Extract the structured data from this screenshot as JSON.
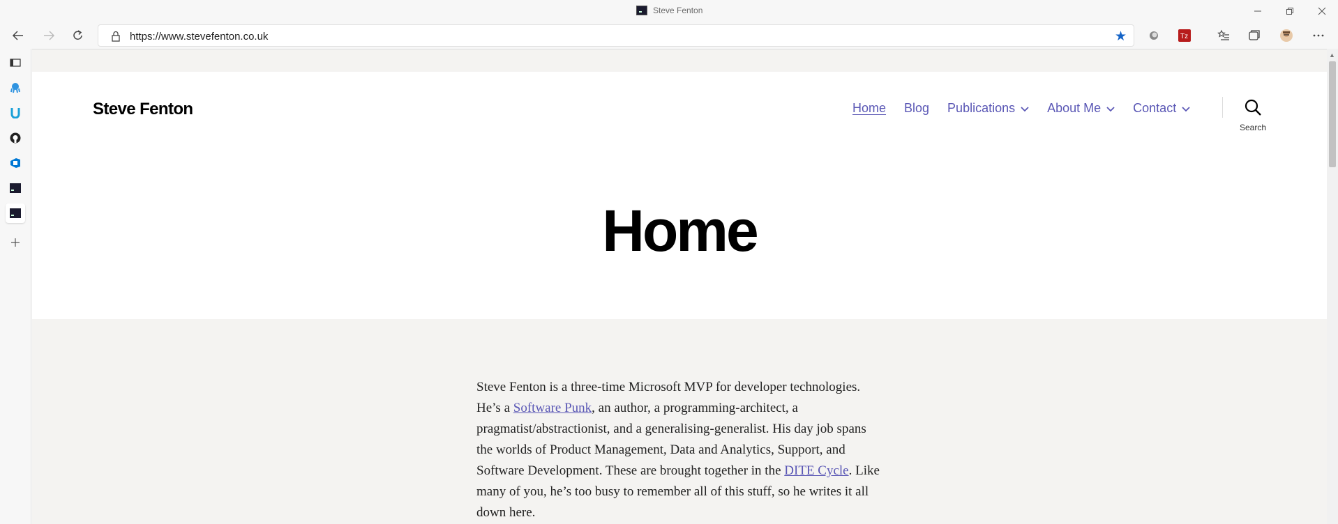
{
  "window": {
    "title": "Steve Fenton"
  },
  "address": {
    "url": "https://www.stevefenton.co.uk"
  },
  "sidebar": {
    "items": [
      "tab-actions-icon",
      "octopus-icon",
      "u-icon",
      "github-icon",
      "azure-devops-icon",
      "terminal-icon",
      "terminal-icon-active",
      "add-icon"
    ]
  },
  "site": {
    "title": "Steve Fenton",
    "nav": [
      {
        "label": "Home",
        "dropdown": false,
        "current": true
      },
      {
        "label": "Blog",
        "dropdown": false
      },
      {
        "label": "Publications",
        "dropdown": true
      },
      {
        "label": "About Me",
        "dropdown": true
      },
      {
        "label": "Contact",
        "dropdown": true
      }
    ],
    "search_label": "Search"
  },
  "page": {
    "heading": "Home",
    "intro_1": "Steve Fenton is a three-time Microsoft MVP for developer technologies. He’s a ",
    "link_1": "Software Punk",
    "intro_2": ", an author, a programming-architect, a pragmatist/abstractionist, and a generalising-generalist. His day job spans the worlds of Product Management, Data and Analytics, Support, and Software Development. These are brought together in the ",
    "link_2": "DITE Cycle",
    "intro_3": ". Like many of you, he’s too busy to remember all of this stuff, so he writes it all down here."
  },
  "colors": {
    "link": "#5a57b5",
    "star": "#1463c7"
  }
}
